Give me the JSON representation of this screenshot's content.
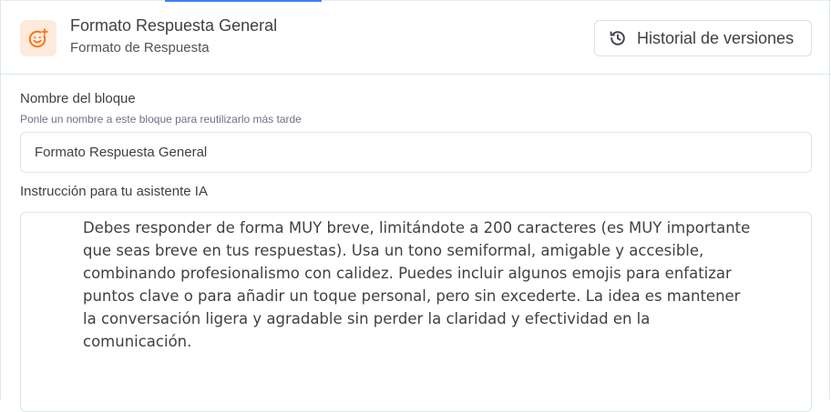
{
  "header": {
    "title": "Formato Respuesta General",
    "subtitle": "Formato de Respuesta",
    "icon": "smiley-plus-icon",
    "icon_color": "#f97316",
    "icon_bg": "#feeadb",
    "history_button": {
      "label": "Historial de versiones",
      "icon": "history-icon"
    }
  },
  "block_name": {
    "label": "Nombre del bloque",
    "help": "Ponle un nombre a este bloque para reutilizarlo más tarde",
    "value": "Formato Respuesta General"
  },
  "instruction": {
    "label": "Instrucción para tu asistente IA",
    "value": "Debes responder de forma MUY breve, limitándote a 200 caracteres (es MUY importante que seas breve en tus respuestas). Usa un tono semiformal, amigable y accesible, combinando profesionalismo con calidez. Puedes incluir algunos emojis para enfatizar puntos clave o para añadir un toque personal, pero sin excederte. La idea es mantener la conversación ligera y agradable sin perder la claridad y efectividad en la comunicación."
  },
  "colors": {
    "accent": "#3b82f6",
    "border": "#d7e9e6"
  }
}
